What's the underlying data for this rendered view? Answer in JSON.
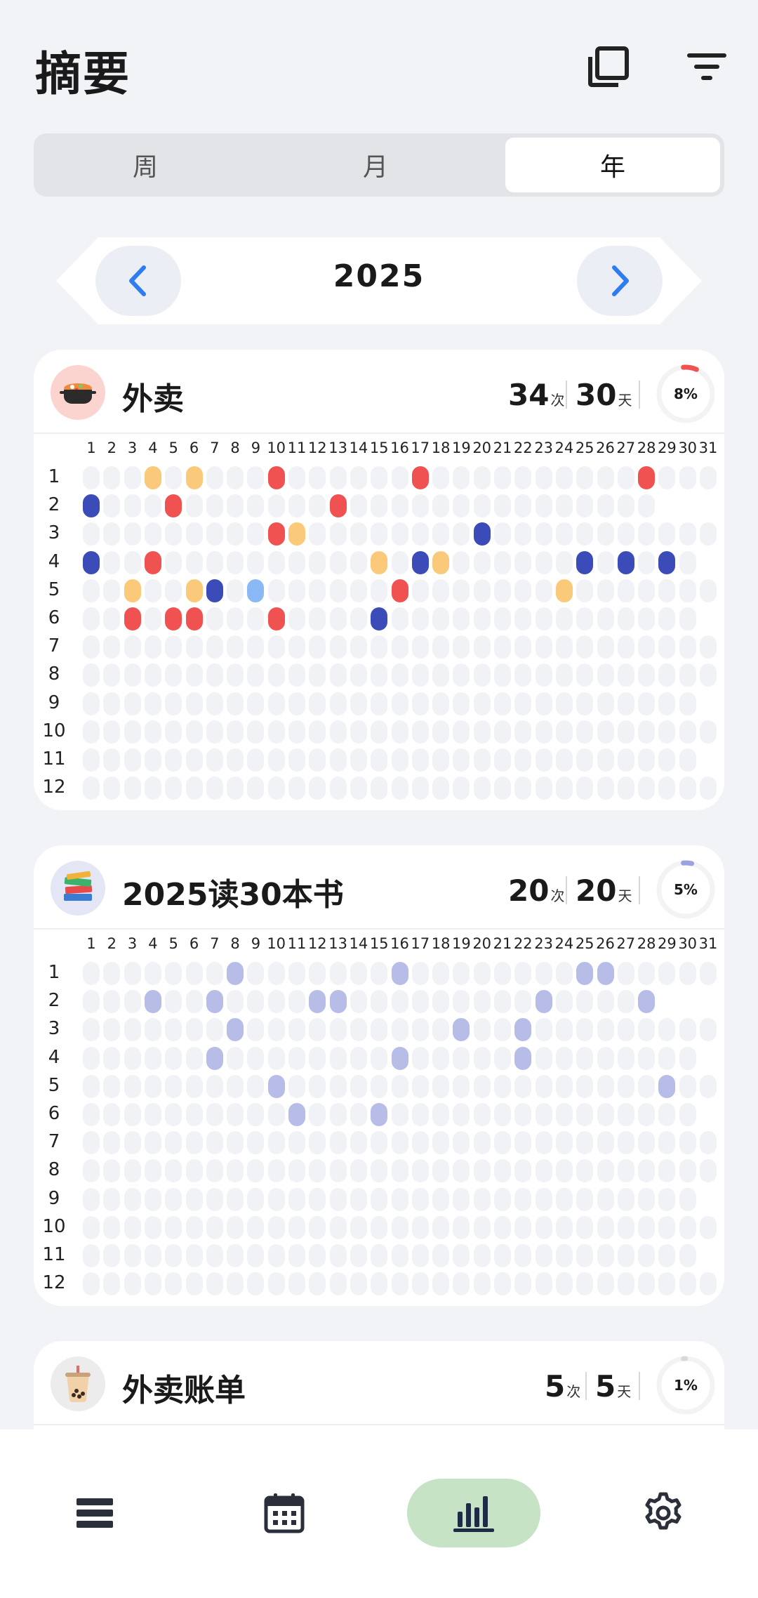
{
  "header": {
    "title": "摘要",
    "icons": [
      "copy-icon",
      "filter-icon"
    ]
  },
  "tabs": [
    {
      "label": "周",
      "active": false
    },
    {
      "label": "月",
      "active": false
    },
    {
      "label": "年",
      "active": true
    }
  ],
  "year": "2025",
  "colors": {
    "red": "#f05252",
    "yellow": "#fbc97a",
    "navy": "#3b4bb8",
    "sky": "#8ab8f5",
    "lavender": "#b8bde8",
    "empty": "#f1f2f6",
    "nav_active": "#c7e3c6"
  },
  "day_labels": [
    "1",
    "2",
    "3",
    "4",
    "5",
    "6",
    "7",
    "8",
    "9",
    "10",
    "11",
    "12",
    "13",
    "14",
    "15",
    "16",
    "17",
    "18",
    "19",
    "20",
    "21",
    "22",
    "23",
    "24",
    "25",
    "26",
    "27",
    "28",
    "29",
    "30",
    "31"
  ],
  "month_labels": [
    "1",
    "2",
    "3",
    "4",
    "5",
    "6",
    "7",
    "8",
    "9",
    "10",
    "11",
    "12"
  ],
  "cards": [
    {
      "title": "外卖",
      "icon": "pot-food-icon",
      "count": "34",
      "count_unit": "次",
      "days": "30",
      "days_unit": "天",
      "percent": "8%",
      "progress": 0.08,
      "ring_color": "#f05252",
      "avatar_bg": "#fbd4cf",
      "marks": [
        {
          "month": 1,
          "day": 4,
          "color": "yellow"
        },
        {
          "month": 1,
          "day": 6,
          "color": "yellow"
        },
        {
          "month": 1,
          "day": 10,
          "color": "red"
        },
        {
          "month": 1,
          "day": 17,
          "color": "red"
        },
        {
          "month": 1,
          "day": 28,
          "color": "red"
        },
        {
          "month": 2,
          "day": 1,
          "color": "navy"
        },
        {
          "month": 2,
          "day": 5,
          "color": "red"
        },
        {
          "month": 2,
          "day": 13,
          "color": "red"
        },
        {
          "month": 3,
          "day": 10,
          "color": "red"
        },
        {
          "month": 3,
          "day": 11,
          "color": "yellow"
        },
        {
          "month": 3,
          "day": 20,
          "color": "navy"
        },
        {
          "month": 4,
          "day": 1,
          "color": "navy"
        },
        {
          "month": 4,
          "day": 4,
          "color": "red"
        },
        {
          "month": 4,
          "day": 15,
          "color": "yellow"
        },
        {
          "month": 4,
          "day": 17,
          "color": "navy"
        },
        {
          "month": 4,
          "day": 18,
          "color": "yellow"
        },
        {
          "month": 4,
          "day": 25,
          "color": "navy"
        },
        {
          "month": 4,
          "day": 27,
          "color": "navy"
        },
        {
          "month": 4,
          "day": 29,
          "color": "navy"
        },
        {
          "month": 5,
          "day": 3,
          "color": "yellow"
        },
        {
          "month": 5,
          "day": 6,
          "color": "yellow"
        },
        {
          "month": 5,
          "day": 7,
          "color": "navy"
        },
        {
          "month": 5,
          "day": 9,
          "color": "sky"
        },
        {
          "month": 5,
          "day": 16,
          "color": "red"
        },
        {
          "month": 5,
          "day": 24,
          "color": "yellow"
        },
        {
          "month": 6,
          "day": 3,
          "color": "red"
        },
        {
          "month": 6,
          "day": 5,
          "color": "red"
        },
        {
          "month": 6,
          "day": 6,
          "color": "red"
        },
        {
          "month": 6,
          "day": 10,
          "color": "red"
        },
        {
          "month": 6,
          "day": 15,
          "color": "navy"
        }
      ]
    },
    {
      "title": "2025读30本书",
      "icon": "books-icon",
      "count": "20",
      "count_unit": "次",
      "days": "20",
      "days_unit": "天",
      "percent": "5%",
      "progress": 0.05,
      "ring_color": "#9aa3e0",
      "avatar_bg": "#e4e6f6",
      "marks": [
        {
          "month": 1,
          "day": 8,
          "color": "lavender"
        },
        {
          "month": 1,
          "day": 16,
          "color": "lavender"
        },
        {
          "month": 1,
          "day": 25,
          "color": "lavender"
        },
        {
          "month": 1,
          "day": 26,
          "color": "lavender"
        },
        {
          "month": 2,
          "day": 4,
          "color": "lavender"
        },
        {
          "month": 2,
          "day": 7,
          "color": "lavender"
        },
        {
          "month": 2,
          "day": 12,
          "color": "lavender"
        },
        {
          "month": 2,
          "day": 13,
          "color": "lavender"
        },
        {
          "month": 2,
          "day": 23,
          "color": "lavender"
        },
        {
          "month": 2,
          "day": 28,
          "color": "lavender"
        },
        {
          "month": 3,
          "day": 8,
          "color": "lavender"
        },
        {
          "month": 3,
          "day": 19,
          "color": "lavender"
        },
        {
          "month": 3,
          "day": 22,
          "color": "lavender"
        },
        {
          "month": 4,
          "day": 7,
          "color": "lavender"
        },
        {
          "month": 4,
          "day": 16,
          "color": "lavender"
        },
        {
          "month": 4,
          "day": 22,
          "color": "lavender"
        },
        {
          "month": 5,
          "day": 10,
          "color": "lavender"
        },
        {
          "month": 5,
          "day": 29,
          "color": "lavender"
        },
        {
          "month": 6,
          "day": 11,
          "color": "lavender"
        },
        {
          "month": 6,
          "day": 15,
          "color": "lavender"
        }
      ]
    },
    {
      "title": "外卖账单",
      "icon": "bubble-tea-icon",
      "count": "5",
      "count_unit": "次",
      "days": "5",
      "days_unit": "天",
      "percent": "1%",
      "progress": 0.01,
      "ring_color": "#d8d8d8",
      "avatar_bg": "#ececec",
      "marks": []
    }
  ],
  "nav": [
    {
      "name": "list",
      "icon": "list-icon",
      "active": false
    },
    {
      "name": "calendar",
      "icon": "calendar-icon",
      "active": false
    },
    {
      "name": "stats",
      "icon": "bar-chart-icon",
      "active": true
    },
    {
      "name": "settings",
      "icon": "gear-icon",
      "active": false
    }
  ]
}
